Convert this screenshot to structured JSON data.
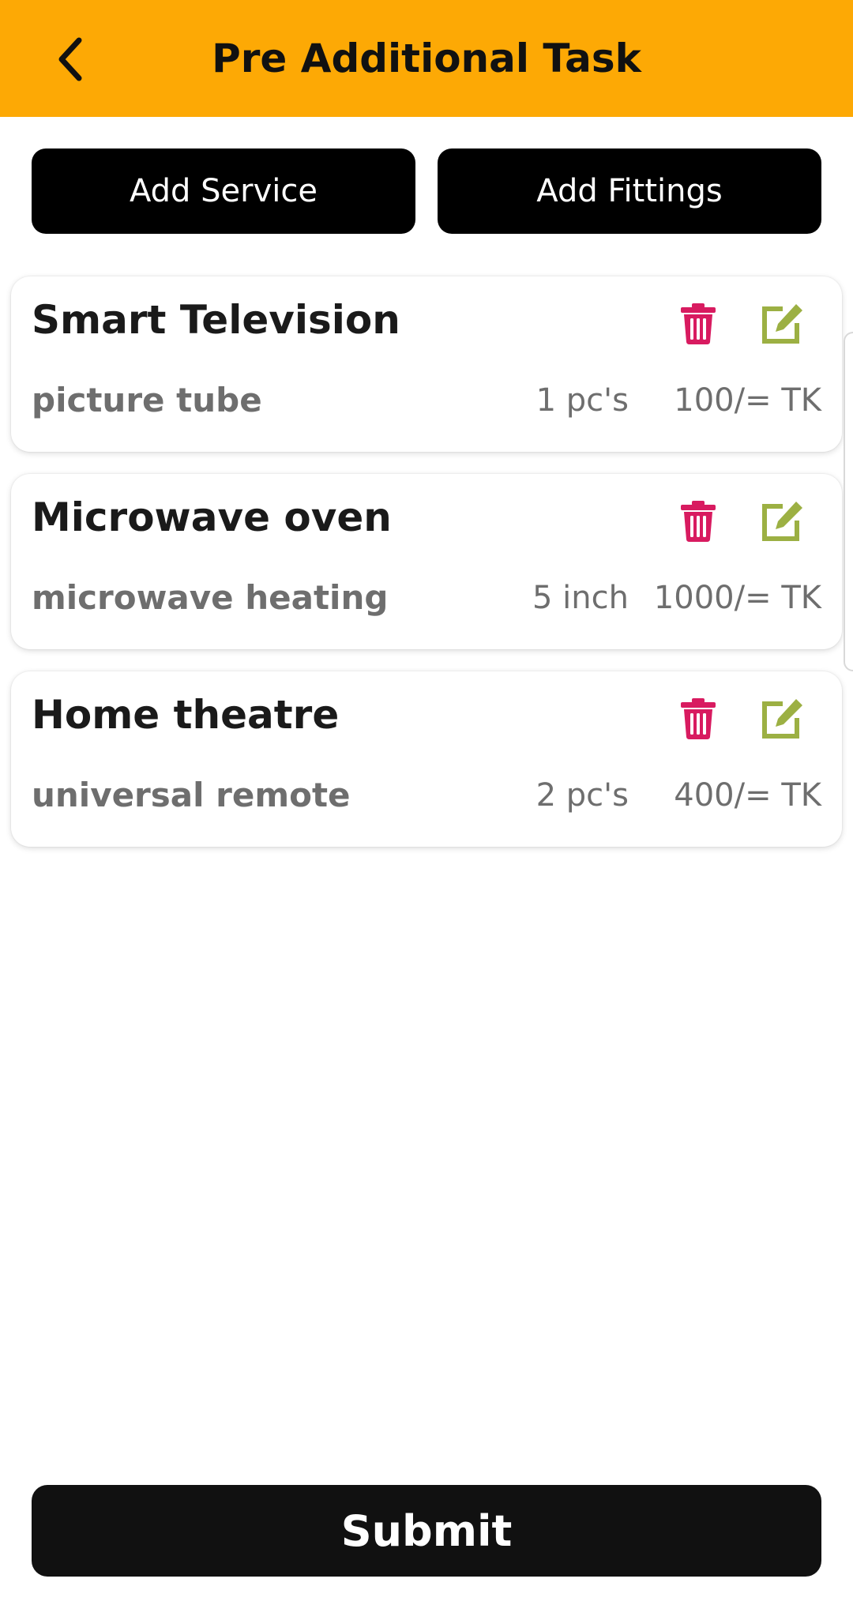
{
  "header": {
    "title": "Pre Additional Task",
    "back_icon": "chevron-left-icon",
    "background_color": "#FDA905"
  },
  "actions": {
    "add_service_label": "Add Service",
    "add_fittings_label": "Add Fittings"
  },
  "items": [
    {
      "title": "Smart Television",
      "description": "picture tube",
      "quantity": "1 pc's",
      "price": "100/= TK"
    },
    {
      "title": "Microwave oven",
      "description": "microwave heating",
      "quantity": "5 inch",
      "price": "1000/= TK"
    },
    {
      "title": "Home theatre",
      "description": "universal remote",
      "quantity": "2 pc's",
      "price": "400/= TK"
    }
  ],
  "icons": {
    "delete": "trash-icon",
    "edit": "edit-icon",
    "delete_color": "#D81B60",
    "edit_color": "#9CB043"
  },
  "footer": {
    "submit_label": "Submit"
  }
}
